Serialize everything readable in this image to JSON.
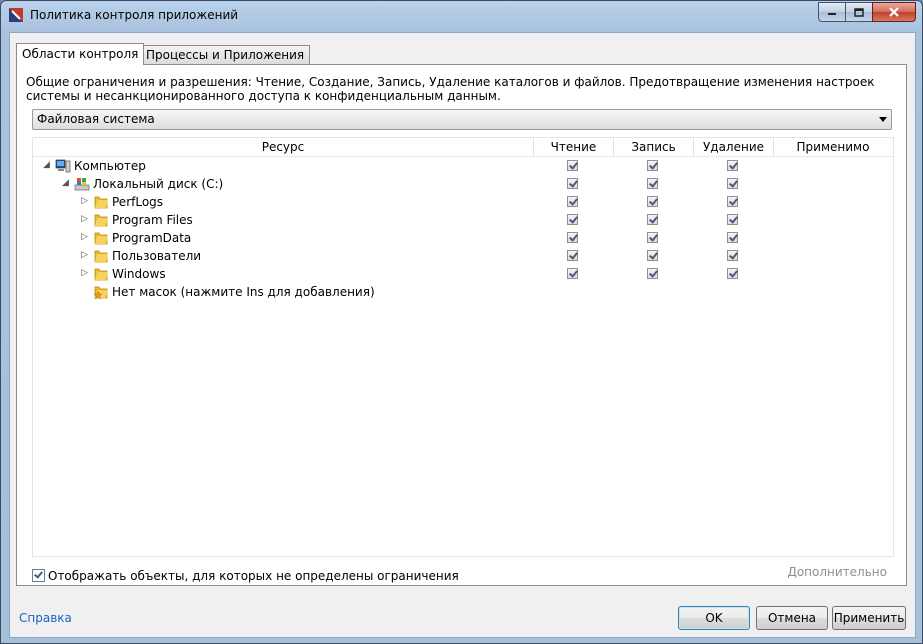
{
  "window": {
    "title": "Политика контроля приложений"
  },
  "tabs": [
    {
      "label": "Области контроля",
      "active": true
    },
    {
      "label": "Процессы и Приложения",
      "active": false
    }
  ],
  "description": "Общие ограничения и разрешения: Чтение, Создание, Запись, Удаление каталогов и файлов. Предотвращение изменения настроек системы и несанкционированного доступа к конфиденциальным данным.",
  "resource_type": {
    "selected": "Файловая система"
  },
  "grid": {
    "columns": {
      "resource": "Ресурс",
      "read": "Чтение",
      "write": "Запись",
      "delete": "Удаление",
      "applies": "Применимо"
    },
    "rows": [
      {
        "label": "Компьютер",
        "icon": "computer-icon",
        "expander": "expanded",
        "read": true,
        "write": true,
        "delete": true
      },
      {
        "label": "Локальный диск (C:)",
        "icon": "drive-icon",
        "expander": "expanded",
        "read": true,
        "write": true,
        "delete": true
      },
      {
        "label": "PerfLogs",
        "icon": "folder-icon",
        "expander": "collapsed",
        "read": true,
        "write": true,
        "delete": true
      },
      {
        "label": "Program Files",
        "icon": "folder-icon",
        "expander": "collapsed",
        "read": true,
        "write": true,
        "delete": true
      },
      {
        "label": "ProgramData",
        "icon": "folder-icon",
        "expander": "collapsed",
        "read": true,
        "write": true,
        "delete": true
      },
      {
        "label": "Пользователи",
        "icon": "folder-icon",
        "expander": "collapsed",
        "read": true,
        "write": true,
        "delete": true
      },
      {
        "label": "Windows",
        "icon": "folder-icon",
        "expander": "collapsed",
        "read": true,
        "write": true,
        "delete": true
      },
      {
        "label": "Нет масок (нажмите Ins для добавления)",
        "icon": "folder-star-icon",
        "expander": "none"
      }
    ]
  },
  "show_all": {
    "label": "Отображать объекты, для которых не определены ограничения",
    "checked": true
  },
  "links": {
    "more": "Дополнительно",
    "help": "Справка"
  },
  "buttons": {
    "ok": "OK",
    "cancel": "Отмена",
    "apply": "Применить"
  }
}
